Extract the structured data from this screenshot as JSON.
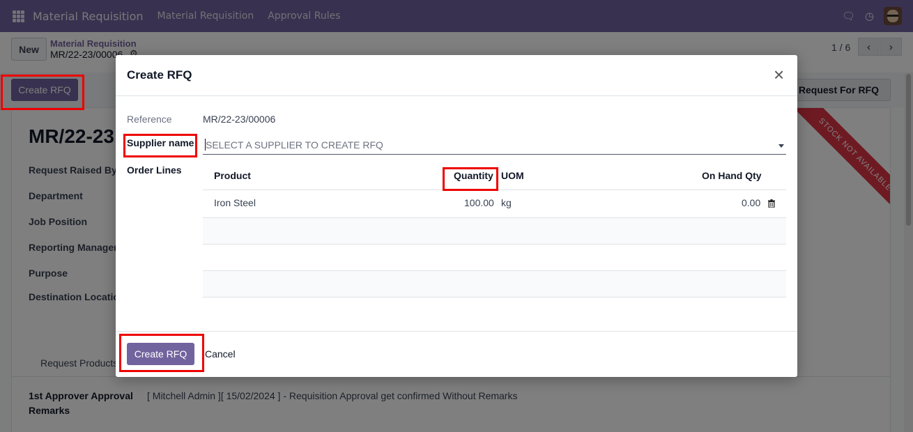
{
  "navbar": {
    "brand": "Material Requisition",
    "menu": [
      "Material Requisition",
      "Approval Rules"
    ]
  },
  "control_panel": {
    "new_label": "New",
    "breadcrumb_parent": "Material Requisition",
    "breadcrumb_current": "MR/22-23/00006",
    "pager": "1 / 6"
  },
  "statusbar": {
    "create_rfq_label": "Create RFQ",
    "request_rfq_label": "Request For RFQ"
  },
  "record": {
    "title": "MR/22-23",
    "ribbon": "STOCK NOT AVAILABLE",
    "labels": [
      "Request Raised By",
      "Department",
      "Job Position",
      "Reporting Manager",
      "Purpose",
      "Destination Locatio"
    ],
    "tab": "Request Products",
    "remarks_label": "1st Approver Approval Remarks",
    "remarks_value": "[ Mitchell Admin ][ 15/02/2024 ] - Requisition Approval get confirmed Without Remarks"
  },
  "modal": {
    "title": "Create RFQ",
    "reference_label": "Reference",
    "reference_value": "MR/22-23/00006",
    "supplier_label": "Supplier name",
    "supplier_placeholder": "SELECT A SUPPLIER TO CREATE RFQ",
    "order_lines_label": "Order Lines",
    "columns": {
      "product": "Product",
      "quantity": "Quantity",
      "uom": "UOM",
      "on_hand": "On Hand Qty"
    },
    "lines": [
      {
        "product": "Iron Steel",
        "quantity": "100.00",
        "uom": "kg",
        "on_hand": "0.00"
      }
    ],
    "create_label": "Create RFQ",
    "cancel_label": "Cancel"
  },
  "colors": {
    "brand": "#71639e",
    "highlight": "#ee0000",
    "ribbon": "#dc3545"
  }
}
